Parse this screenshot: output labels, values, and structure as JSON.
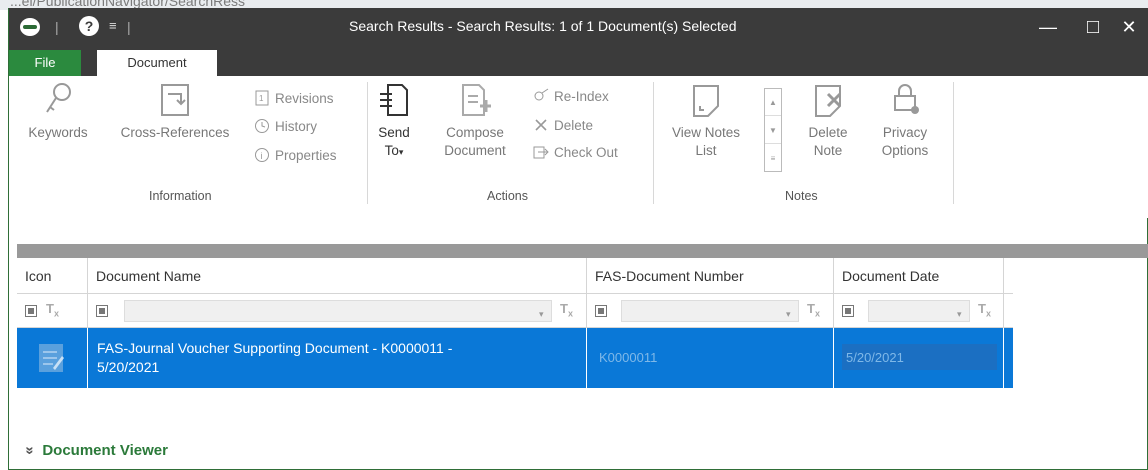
{
  "url_fragment": "...el/PublicationNavigator/SearchRess",
  "window": {
    "title": "Search Results - Search Results: 1 of 1 Document(s) Selected",
    "help_glyph": "?",
    "quick_access_glyph": "≡",
    "minimize_glyph": "—",
    "maximize_glyph": "□",
    "close_glyph": "✕"
  },
  "tabs": {
    "file": "File",
    "document": "Document"
  },
  "ribbon": {
    "information": {
      "label": "Information",
      "keywords": "Keywords",
      "cross_references": "Cross-References",
      "revisions": "Revisions",
      "history": "History",
      "properties": "Properties"
    },
    "actions": {
      "label": "Actions",
      "send_to_line1": "Send",
      "send_to_line2": "To",
      "compose_line1": "Compose",
      "compose_line2": "Document",
      "reindex": "Re-Index",
      "delete": "Delete",
      "checkout": "Check Out"
    },
    "notes": {
      "label": "Notes",
      "view_notes_line1": "View Notes",
      "view_notes_line2": "List",
      "delete_note_line1": "Delete",
      "delete_note_line2": "Note",
      "privacy_line1": "Privacy",
      "privacy_line2": "Options"
    }
  },
  "grid": {
    "columns": {
      "icon": "Icon",
      "document_name": "Document Name",
      "document_number": "FAS-Document Number",
      "document_date": "Document Date"
    },
    "filter_clear_glyph": "T",
    "filter_clear_sub": "x",
    "filter_drop_glyph": "▾",
    "rows": [
      {
        "name_line1": "FAS-Journal Voucher Supporting Document - K0000011 -",
        "name_line2": "5/20/2021",
        "number": "K0000011",
        "date": "5/20/2021"
      }
    ]
  },
  "viewer": {
    "label": "Document Viewer",
    "chevron": "»"
  },
  "colors": {
    "titlebar": "#3b3b3b",
    "file_tab": "#2b8a3e",
    "selected_row": "#0a78d7",
    "viewer_link": "#2b7a3a"
  }
}
